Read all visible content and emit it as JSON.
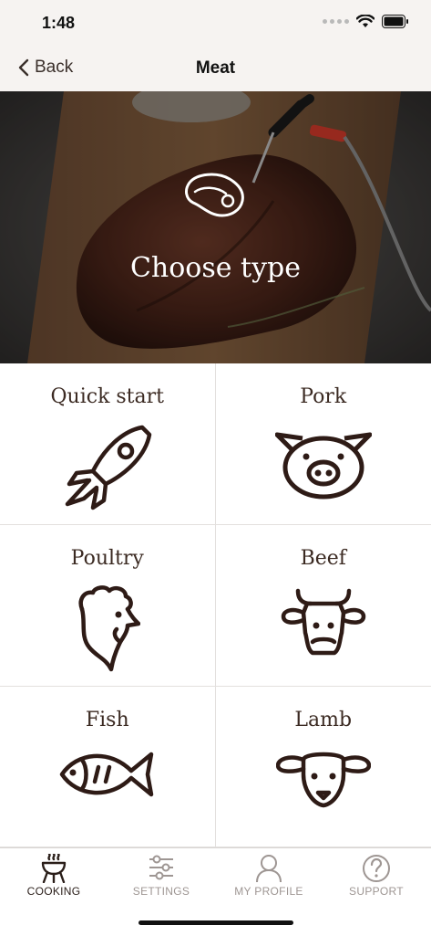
{
  "status": {
    "time": "1:48"
  },
  "nav": {
    "back_label": "Back",
    "title": "Meat"
  },
  "hero": {
    "title": "Choose type"
  },
  "categories": [
    {
      "label": "Quick start",
      "icon": "rocket-icon"
    },
    {
      "label": "Pork",
      "icon": "pig-icon"
    },
    {
      "label": "Poultry",
      "icon": "rooster-icon"
    },
    {
      "label": "Beef",
      "icon": "cow-icon"
    },
    {
      "label": "Fish",
      "icon": "fish-icon"
    },
    {
      "label": "Lamb",
      "icon": "lamb-icon"
    }
  ],
  "tabs": [
    {
      "label": "COOKING",
      "icon": "grill-icon",
      "active": true
    },
    {
      "label": "SETTINGS",
      "icon": "sliders-icon",
      "active": false
    },
    {
      "label": "MY PROFILE",
      "icon": "person-icon",
      "active": false
    },
    {
      "label": "SUPPORT",
      "icon": "question-icon",
      "active": false
    }
  ],
  "colors": {
    "icon": "#2e1b16",
    "label": "#3b2a22",
    "tab_inactive": "#9e9693",
    "nav_bg": "#f6f3f1"
  }
}
